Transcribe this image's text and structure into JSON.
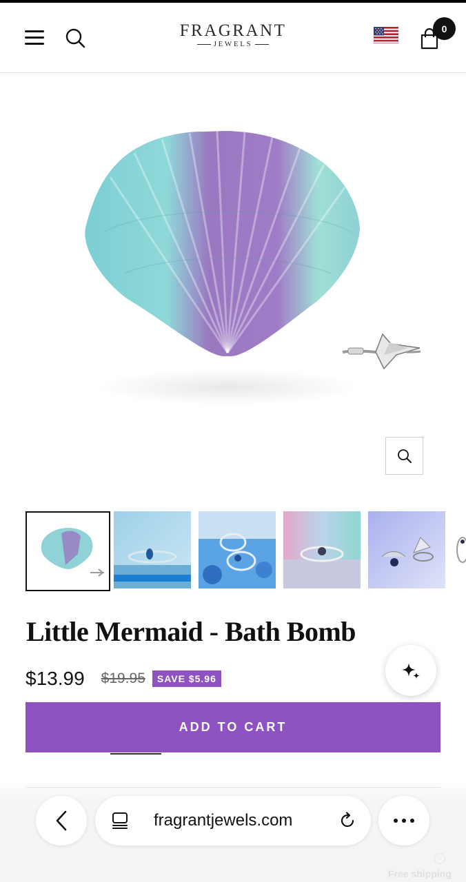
{
  "header": {
    "logo_main": "FRAGRANT",
    "logo_sub": "JEWELS",
    "cart_count": "0"
  },
  "product": {
    "title": "Little Mermaid - Bath Bomb",
    "price": "$13.99",
    "compare_price": "$19.95",
    "save_badge": "SAVE $5.96",
    "add_to_cart_label": "ADD TO CART"
  },
  "gallery": {
    "thumbnail_count": 6,
    "active_index": 0
  },
  "browser": {
    "url": "fragrantjewels.com"
  },
  "footer_hint": {
    "free_shipping": "Free shipping"
  },
  "colors": {
    "accent": "#8e52c2",
    "text": "#111111"
  }
}
